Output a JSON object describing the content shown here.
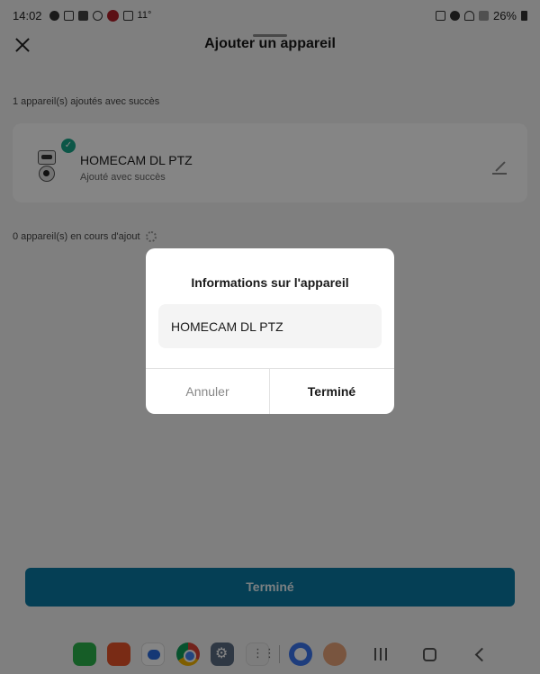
{
  "status_bar": {
    "time": "14:02",
    "temperature": "11°",
    "battery": "26%",
    "icons": [
      "whatsapp-icon",
      "lock-icon",
      "teams-icon",
      "cloud-icon",
      "app-red-icon",
      "image-icon",
      "alarm-icon",
      "wifi-icon",
      "signal-icon",
      "battery-icon"
    ]
  },
  "header": {
    "title": "Ajouter un appareil",
    "close_icon": "close-icon"
  },
  "added_section": {
    "label": "1 appareil(s) ajoutés avec succès",
    "devices": [
      {
        "name": "HOMECAM DL PTZ",
        "status": "Ajouté avec succès",
        "icon": "camera-icon"
      }
    ]
  },
  "pending_section": {
    "label": "0 appareil(s) en cours d'ajout"
  },
  "main_button": {
    "label": "Terminé",
    "color": "#0b7aa3"
  },
  "dialog": {
    "title": "Informations sur l'appareil",
    "input_value": "HOMECAM DL PTZ",
    "cancel_label": "Annuler",
    "confirm_label": "Terminé"
  },
  "dock": {
    "apps": [
      "phone-icon",
      "mail-icon",
      "messages-icon",
      "chrome-icon",
      "settings-icon",
      "app-drawer-icon",
      "signal-app-icon",
      "avatar-icon"
    ]
  },
  "colors": {
    "accent": "#0b7aa3",
    "success": "#17a589",
    "background": "#f4f4f4"
  }
}
